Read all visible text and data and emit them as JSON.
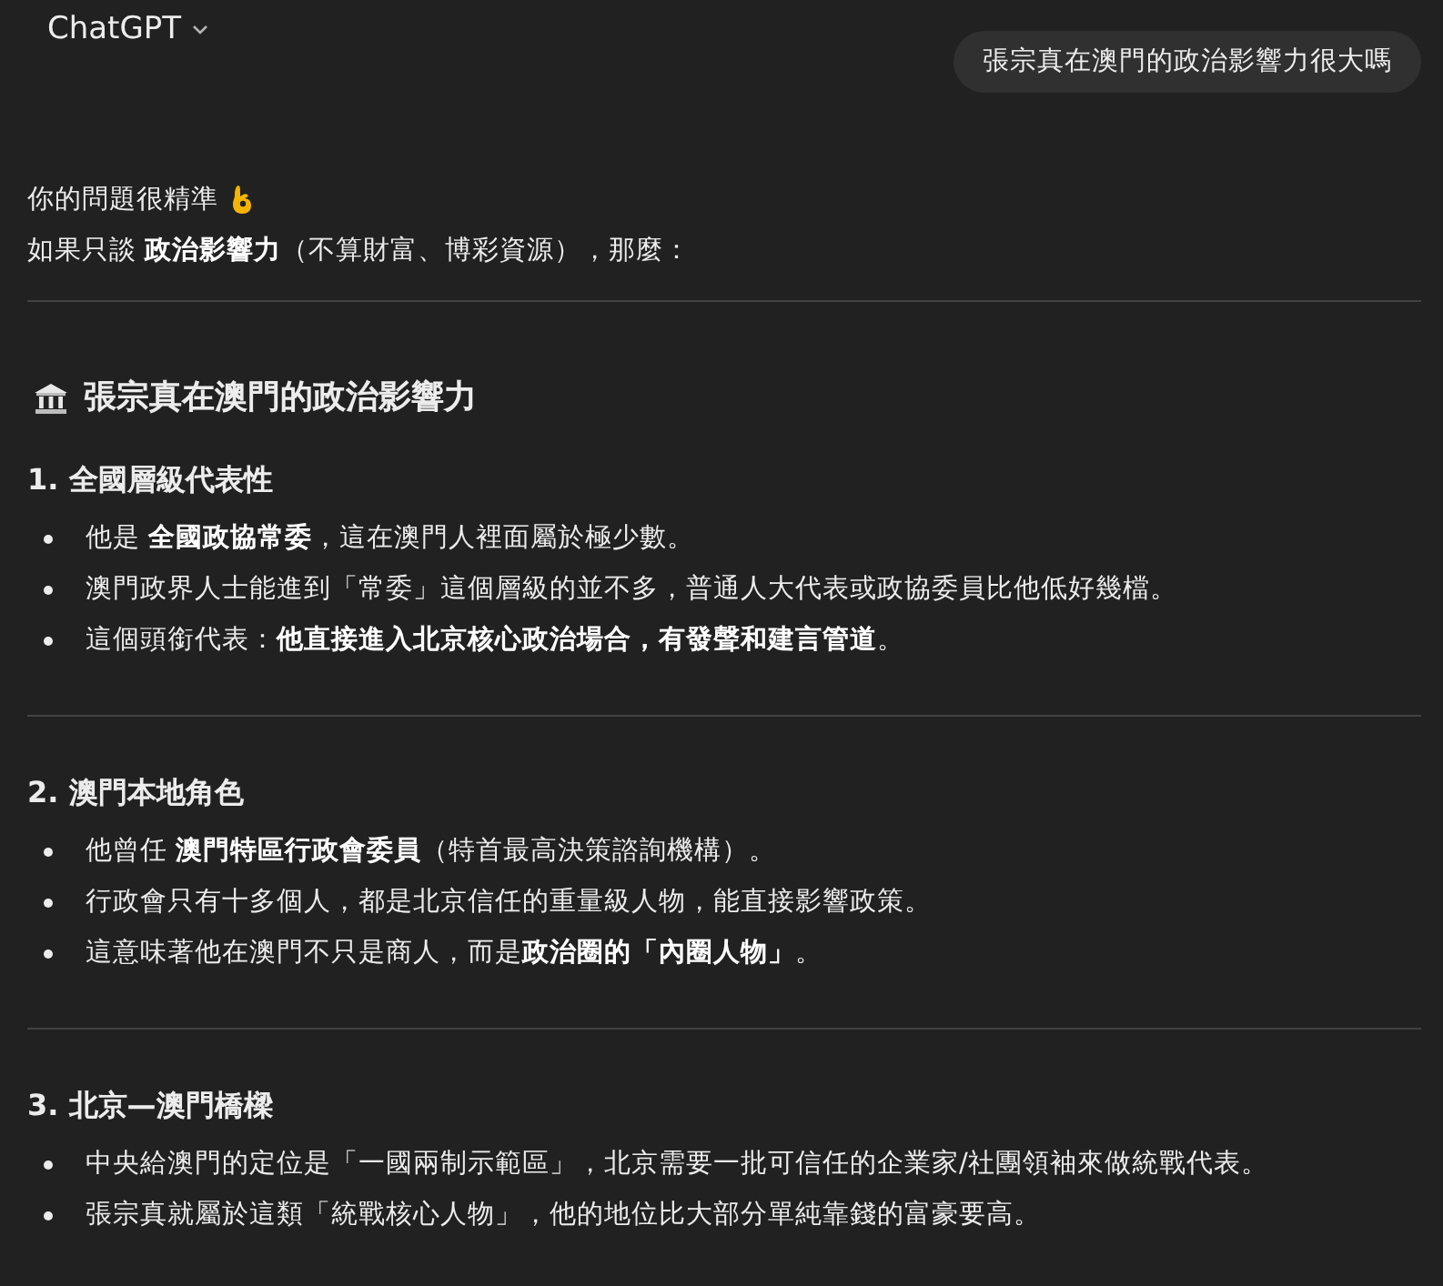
{
  "header": {
    "title": "ChatGPT"
  },
  "user_message": "張宗真在澳門的政治影響力很大嗎",
  "reply": {
    "intro": [
      "你的問題很精準",
      "如果只談 **政治影響力**（不算財富、博彩資源），那麼："
    ],
    "title": "張宗真在澳門的政治影響力",
    "sections": [
      {
        "heading": "1. 全國層級代表性",
        "bullets": [
          "他是 **全國政協常委**，這在澳門人裡面屬於極少數。",
          "澳門政界人士能進到「常委」這個層級的並不多，普通人大代表或政協委員比他低好幾檔。",
          "這個頭銜代表：**他直接進入北京核心政治場合，有發聲和建言管道**。"
        ]
      },
      {
        "heading": "2. 澳門本地角色",
        "bullets": [
          "他曾任 **澳門特區行政會委員**（特首最高決策諮詢機構）。",
          "行政會只有十多個人，都是北京信任的重量級人物，能直接影響政策。",
          "這意味著他在澳門不只是商人，而是**政治圈的「內圈人物」**。"
        ]
      },
      {
        "heading": "3. 北京—澳門橋樑",
        "bullets": [
          "中央給澳門的定位是「一國兩制示範區」，北京需要一批可信任的企業家/社團領袖來做統戰代表。",
          "張宗真就屬於這類「統戰核心人物」，他的地位比大部分單純靠錢的富豪要高。"
        ]
      }
    ]
  }
}
